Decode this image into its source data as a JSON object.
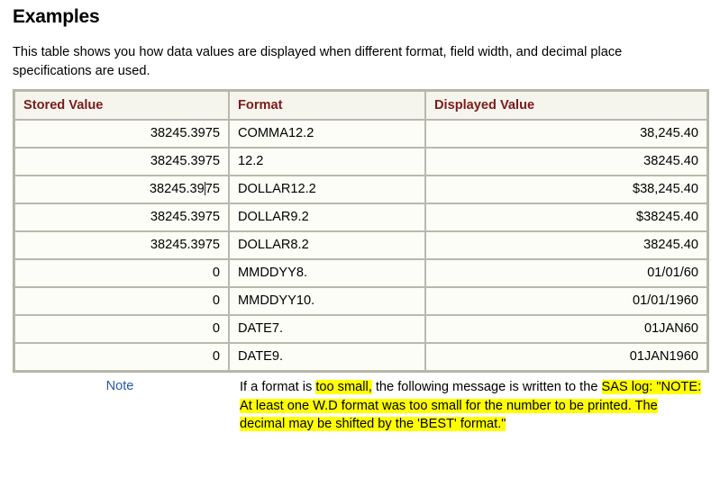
{
  "page": {
    "title": "Examples",
    "intro": "This table shows you how data values are displayed when different format, field width, and decimal place specifications are used."
  },
  "colors": {
    "header_text": "#7c1a1a",
    "note_label": "#2a58a8",
    "highlight": "#ffff00",
    "table_border": "#b9b9ab",
    "cell_background": "#fdfdf7",
    "header_background": "#f5f5ed"
  },
  "table": {
    "headers": [
      "Stored Value",
      "Format",
      "Displayed Value"
    ],
    "rows": [
      {
        "stored": "38245.3975",
        "format": "COMMA12.2",
        "displayed": "38,245.40"
      },
      {
        "stored": "38245.3975",
        "format": "12.2",
        "displayed": "38245.40"
      },
      {
        "stored_pre": "38245.39",
        "stored_post": "75",
        "has_caret": true,
        "stored": "38245.3975",
        "format": "DOLLAR12.2",
        "displayed": "$38,245.40"
      },
      {
        "stored": "38245.3975",
        "format": "DOLLAR9.2",
        "displayed": "$38245.40"
      },
      {
        "stored": "38245.3975",
        "format": "DOLLAR8.2",
        "displayed": "38245.40"
      },
      {
        "stored": "0",
        "format": "MMDDYY8.",
        "displayed": "01/01/60"
      },
      {
        "stored": "0",
        "format": "MMDDYY10.",
        "displayed": "01/01/1960"
      },
      {
        "stored": "0",
        "format": "DATE7.",
        "displayed": "01JAN60"
      },
      {
        "stored": "0",
        "format": "DATE9.",
        "displayed": "01JAN1960"
      }
    ]
  },
  "note": {
    "label": "Note",
    "seg1": "If a format is ",
    "seg2_highlight": "too small,",
    "seg3": " the following message is written to the ",
    "seg4_highlight": "SAS log: \"NOTE: At least one W.D format was too small for the number to be printed. The decimal may be shifted by the 'BEST' format.\""
  }
}
